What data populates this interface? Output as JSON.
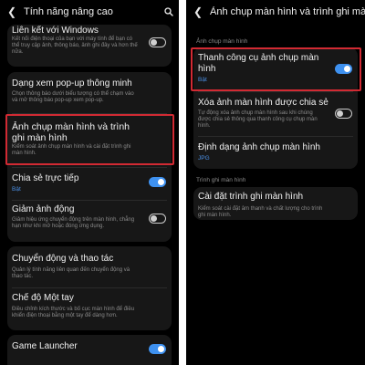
{
  "left": {
    "header": {
      "title": "Tính năng nâng cao"
    },
    "items": [
      {
        "title": "Liên kết với Windows",
        "subtitle": "Kết nối điện thoại của bạn với máy tính để bạn có thể truy cập ảnh, thông báo, ảnh ghi đây và hơn thế nữa.",
        "toggle": "off"
      },
      {
        "title": "Dạng xem pop-up thông minh",
        "subtitle": "Chọn thông báo dưới biểu tượng có thể chạm vào và mở thông báo pop-up xem pop-up."
      },
      {
        "title": "Ảnh chụp màn hình và trình ghi màn hình",
        "subtitle": "Kiểm soát ảnh chụp màn hình và cài đặt trình ghi màn hình."
      },
      {
        "title": "Chia sẻ trực tiếp",
        "status": "Bật",
        "toggle": "on"
      },
      {
        "title": "Giảm ảnh động",
        "subtitle": "Giảm hiệu ứng chuyển động trên màn hình, chẳng hạn như khi mở hoặc đóng ứng dụng.",
        "toggle": "off"
      },
      {
        "title": "Chuyển động và thao tác",
        "subtitle": "Quản lý tính năng liên quan đến chuyển động và thao tác."
      },
      {
        "title": "Chế độ Một tay",
        "subtitle": "Điều chỉnh kích thước và bố cục màn hình để điều khiển điện thoại bằng một tay để dàng hơn."
      },
      {
        "title": "Game Launcher",
        "toggle": "on"
      }
    ]
  },
  "right": {
    "header": {
      "title": "Ảnh chụp màn hình và trình ghi màn hình"
    },
    "sections": [
      {
        "label": "Ảnh chụp màn hình",
        "items": [
          {
            "title": "Thanh công cụ ảnh chụp màn hình",
            "status": "Bật",
            "toggle": "on"
          },
          {
            "title": "Xóa ảnh màn hình được chia sẻ",
            "subtitle": "Tự động xóa ảnh chụp màn hình sau khi chúng được chia sẻ thông qua thanh công cụ chụp màn hình.",
            "toggle": "off"
          },
          {
            "title": "Định dạng ảnh chụp màn hình",
            "status": "JPG"
          }
        ]
      },
      {
        "label": "Trình ghi màn hình",
        "items": [
          {
            "title": "Cài đặt trình ghi màn hình",
            "subtitle": "Kiểm soát cài đặt âm thanh và chất lượng cho trình ghi màn hình."
          }
        ]
      }
    ]
  },
  "colors": {
    "accent": "#3e91f0",
    "highlight": "#d22a33",
    "card": "#171717",
    "background": "#000000"
  },
  "icons": {
    "back": "back-arrow-icon",
    "search": "search-icon"
  }
}
